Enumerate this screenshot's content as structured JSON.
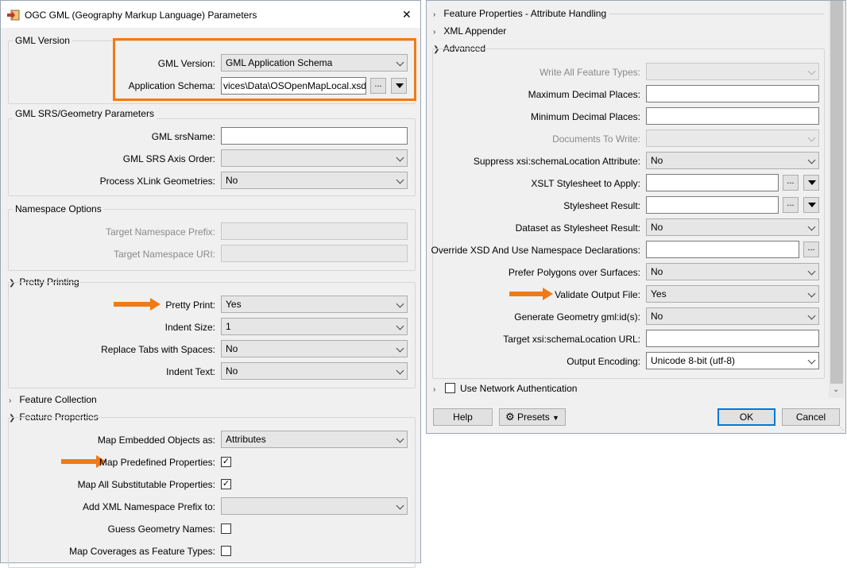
{
  "left": {
    "title": "OGC GML (Geography Markup Language) Parameters",
    "close": "✕",
    "gml_version_group": {
      "title": "GML Version",
      "version_label": "GML Version:",
      "version_value": "GML Application Schema",
      "schema_label": "Application Schema:",
      "schema_value": "vices\\Data\\OSOpenMapLocal.xsd\""
    },
    "srs_group": {
      "title": "GML SRS/Geometry Parameters",
      "srsname_label": "GML srsName:",
      "srsname_value": "",
      "axis_label": "GML SRS Axis Order:",
      "axis_value": "",
      "xlink_label": "Process XLink Geometries:",
      "xlink_value": "No"
    },
    "ns_group": {
      "title": "Namespace Options",
      "prefix_label": "Target Namespace Prefix:",
      "uri_label": "Target Namespace URI:"
    },
    "pretty": {
      "title": "Pretty Printing",
      "print_label": "Pretty Print:",
      "print_value": "Yes",
      "indent_label": "Indent Size:",
      "indent_value": "1",
      "tabs_label": "Replace Tabs with Spaces:",
      "tabs_value": "No",
      "indent_text_label": "Indent Text:",
      "indent_text_value": "No"
    },
    "feature_collection": "Feature Collection",
    "feature_props": {
      "title": "Feature Properties",
      "embedded_label": "Map Embedded Objects as:",
      "embedded_value": "Attributes",
      "predefined_label": "Map Predefined Properties:",
      "substitutable_label": "Map All Substitutable Properties:",
      "xmlns_label": "Add XML Namespace Prefix to:",
      "xmlns_value": "",
      "guess_label": "Guess Geometry Names:",
      "coverages_label": "Map Coverages as Feature Types:"
    }
  },
  "right": {
    "sec_attr": "Feature Properties - Attribute Handling",
    "sec_xml": "XML Appender",
    "sec_adv": "Advanced",
    "adv": {
      "write_all_label": "Write All Feature Types:",
      "max_dec_label": "Maximum Decimal Places:",
      "min_dec_label": "Minimum Decimal Places:",
      "docs_label": "Documents To Write:",
      "suppress_label": "Suppress xsi:schemaLocation Attribute:",
      "suppress_value": "No",
      "xslt_label": "XSLT Stylesheet to Apply:",
      "result_label": "Stylesheet Result:",
      "dataset_label": "Dataset as Stylesheet Result:",
      "dataset_value": "No",
      "override_label": "Override XSD And Use Namespace Declarations:",
      "prefer_label": "Prefer Polygons over Surfaces:",
      "prefer_value": "No",
      "validate_label": "Validate Output File:",
      "validate_value": "Yes",
      "gmlid_label": "Generate Geometry gml:id(s):",
      "gmlid_value": "No",
      "target_label": "Target xsi:schemaLocation URL:",
      "encoding_label": "Output Encoding:",
      "encoding_value": "Unicode 8-bit (utf-8)"
    },
    "network_auth": "Use Network Authentication",
    "buttons": {
      "help": "Help",
      "presets": "Presets",
      "ok": "OK",
      "cancel": "Cancel",
      "ellipsis": "..."
    }
  },
  "colors": {
    "accent": "#ef7a16",
    "panel_bg": "#f0f0f0"
  }
}
